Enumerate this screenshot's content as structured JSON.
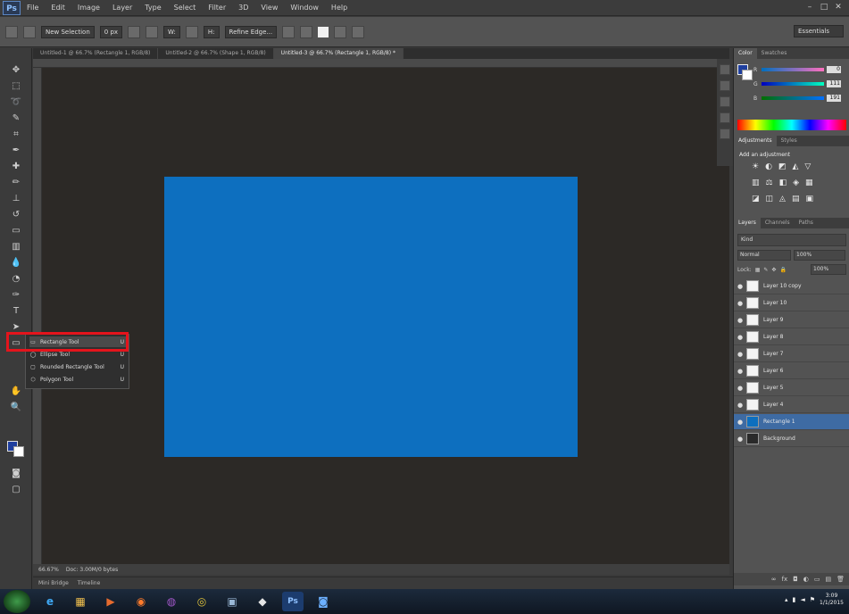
{
  "app": {
    "logo": "Ps"
  },
  "menubar": {
    "items": [
      "File",
      "Edit",
      "Image",
      "Layer",
      "Type",
      "Select",
      "Filter",
      "3D",
      "View",
      "Window",
      "Help"
    ],
    "window_controls": [
      "minimize",
      "maximize",
      "close"
    ]
  },
  "options_bar": {
    "mode_label": "New Selection",
    "feather": "0 px",
    "width": "W:",
    "height": "H:",
    "refine": "Refine Edge...",
    "workspace": "Essentials"
  },
  "tabs": [
    {
      "label": "Untitled-1 @ 66.7% (Rectangle 1, RGB/8)"
    },
    {
      "label": "Untitled-2 @ 66.7% (Shape 1, RGB/8)"
    },
    {
      "label": "Untitled-3 @ 66.7% (Rectangle 1, RGB/8) *"
    }
  ],
  "status": {
    "zoom": "66.67%",
    "doc_size": "Doc: 3.00M/0 bytes"
  },
  "minibridge": {
    "tabs": [
      "Mini Bridge",
      "Timeline"
    ]
  },
  "flyout": {
    "items": [
      {
        "icon": "rectangle-tool-icon",
        "label": "Rectangle Tool",
        "key": "U",
        "selected": true
      },
      {
        "icon": "rounded-rectangle-tool-icon",
        "label": "Ellipse Tool",
        "key": "U",
        "selected": false
      },
      {
        "icon": "polygon-tool-icon",
        "label": "Rounded Rectangle Tool",
        "key": "U",
        "selected": false
      },
      {
        "icon": "custom-shape-tool-icon",
        "label": "Polygon Tool",
        "key": "U",
        "selected": false
      }
    ]
  },
  "color_panel": {
    "tabs": [
      "Color",
      "Swatches"
    ],
    "channels": [
      {
        "label": "R",
        "value": "0"
      },
      {
        "label": "G",
        "value": "111"
      },
      {
        "label": "B",
        "value": "191"
      }
    ],
    "foreground": "#1f3f9f",
    "background": "#ffffff"
  },
  "adjustments_panel": {
    "tabs": [
      "Adjustments",
      "Styles"
    ],
    "title": "Add an adjustment",
    "rows": [
      [
        "☀",
        "◐",
        "◩",
        "◭",
        "▽"
      ],
      [
        "▥",
        "⚖",
        "◧",
        "◈",
        "▦"
      ],
      [
        "◪",
        "◫",
        "◬",
        "▤",
        "▣"
      ]
    ]
  },
  "layers_panel": {
    "tabs": [
      "Layers",
      "Channels",
      "Paths"
    ],
    "filter": "Kind",
    "blend_mode": "Normal",
    "opacity": "100%",
    "fill": "100%",
    "lock_label": "Lock:",
    "layers": [
      {
        "name": "Layer 10 copy",
        "selected": false
      },
      {
        "name": "Layer 10",
        "selected": false
      },
      {
        "name": "Layer 9",
        "selected": false
      },
      {
        "name": "Layer 8",
        "selected": false
      },
      {
        "name": "Layer 7",
        "selected": false
      },
      {
        "name": "Layer 6",
        "selected": false
      },
      {
        "name": "Layer 5",
        "selected": false
      },
      {
        "name": "Layer 4",
        "selected": false
      },
      {
        "name": "Rectangle 1",
        "selected": true
      },
      {
        "name": "Background",
        "selected": false
      }
    ]
  },
  "canvas": {
    "fill": "#0d6fbf"
  },
  "highlight_color": "#e4141c",
  "taskbar": {
    "apps": [
      {
        "icon": "ie-icon",
        "glyph": "e"
      },
      {
        "icon": "explorer-icon",
        "glyph": "▦"
      },
      {
        "icon": "media-icon",
        "glyph": "▶"
      },
      {
        "icon": "firefox-icon",
        "glyph": "◉"
      },
      {
        "icon": "app-icon",
        "glyph": "◍"
      },
      {
        "icon": "chrome-icon",
        "glyph": "◎"
      },
      {
        "icon": "app2-icon",
        "glyph": "▣"
      },
      {
        "icon": "app3-icon",
        "glyph": "◆"
      },
      {
        "icon": "photoshop-task-icon",
        "glyph": "Ps"
      },
      {
        "icon": "app4-icon",
        "glyph": "◙"
      }
    ],
    "time": "3:09",
    "date": "1/1/2015"
  }
}
